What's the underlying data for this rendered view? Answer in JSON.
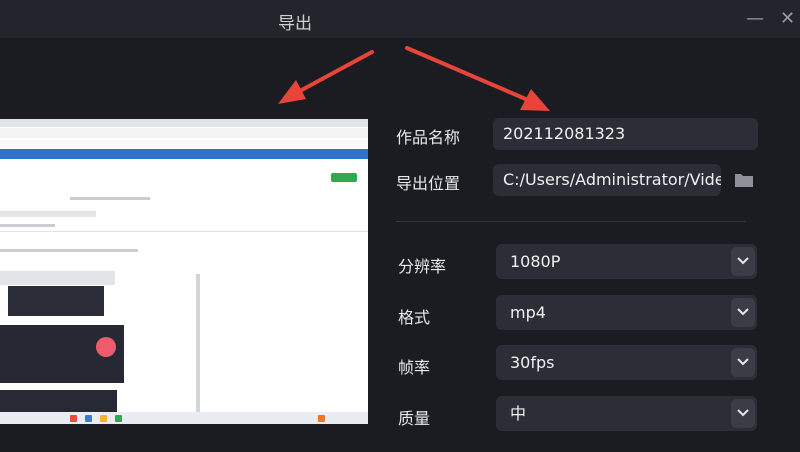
{
  "window": {
    "title": "导出",
    "minimize_glyph": "—",
    "close_glyph": "✕"
  },
  "preview": {
    "description_icon": "screen-capture-thumbnail"
  },
  "form": {
    "name_label": "作品名称",
    "name_value": "202112081323",
    "location_label": "导出位置",
    "location_value": "C:/Users/Administrator/Vide",
    "resolution_label": "分辨率",
    "resolution_value": "1080P",
    "format_label": "格式",
    "format_value": "mp4",
    "framerate_label": "帧率",
    "framerate_value": "30fps",
    "quality_label": "质量",
    "quality_value": "中"
  },
  "colors": {
    "background": "#1b1c22",
    "titlebar": "#24252c",
    "field": "#2c2e37",
    "arrow": "#e8443a"
  }
}
